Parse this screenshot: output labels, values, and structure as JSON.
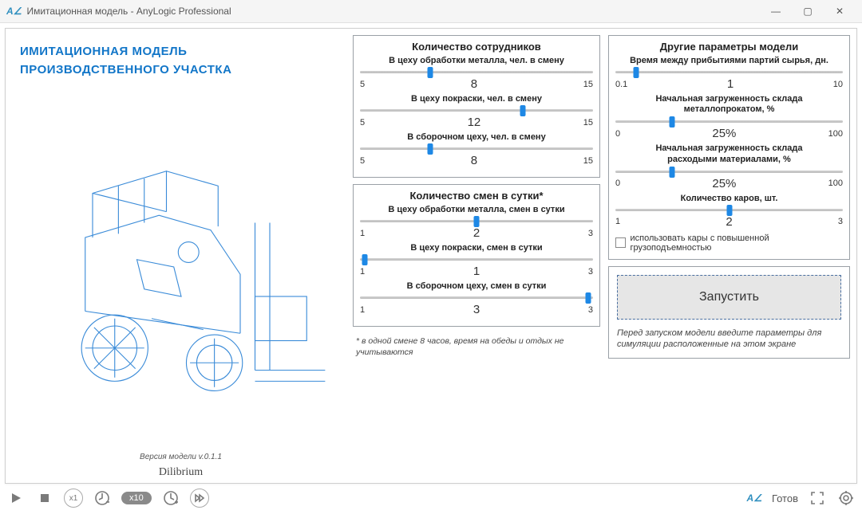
{
  "window": {
    "title": "Имитационная модель - AnyLogic Professional"
  },
  "model": {
    "heading_line1": "ИМИТАЦИОННАЯ МОДЕЛЬ",
    "heading_line2": "ПРОИЗВОДСТВЕННОГО УЧАСТКА",
    "version": "Версия модели v.0.1.1",
    "brand": "Dilibrium"
  },
  "panels": {
    "employees": {
      "title": "Количество сотрудников",
      "sliders": [
        {
          "label": "В цеху обработки металла, чел. в смену",
          "min": "5",
          "max": "15",
          "value": "8",
          "pos": 30
        },
        {
          "label": "В цеху покраски, чел. в смену",
          "min": "5",
          "max": "15",
          "value": "12",
          "pos": 70
        },
        {
          "label": "В сборочном цеху, чел. в смену",
          "min": "5",
          "max": "15",
          "value": "8",
          "pos": 30
        }
      ]
    },
    "shifts": {
      "title": "Количество смен в сутки*",
      "sliders": [
        {
          "label": "В цеху обработки металла, смен в сутки",
          "min": "1",
          "max": "3",
          "value": "2",
          "pos": 50
        },
        {
          "label": "В цеху покраски, смен в сутки",
          "min": "1",
          "max": "3",
          "value": "1",
          "pos": 2
        },
        {
          "label": "В сборочном цеху, смен в сутки",
          "min": "1",
          "max": "3",
          "value": "3",
          "pos": 98
        }
      ],
      "footnote": "* в одной смене 8 часов, время на обеды и отдых не учитываются"
    },
    "other": {
      "title": "Другие параметры модели",
      "sliders": [
        {
          "label": "Время между прибытиями партий сырья, дн.",
          "label2": "",
          "min": "0.1",
          "max": "10",
          "value": "1",
          "pos": 9
        },
        {
          "label": "Начальная загруженность склада",
          "label2": "металлопрокатом, %",
          "min": "0",
          "max": "100",
          "value": "25%",
          "pos": 25
        },
        {
          "label": "Начальная загруженность склада",
          "label2": "расходыми материалами, %",
          "min": "0",
          "max": "100",
          "value": "25%",
          "pos": 25
        },
        {
          "label": "Количество каров, шт.",
          "label2": "",
          "min": "1",
          "max": "3",
          "value": "2",
          "pos": 50
        }
      ],
      "checkbox_label": "использовать кары с повышенной грузоподъемностью",
      "checkbox_checked": false
    }
  },
  "run": {
    "button": "Запустить",
    "note": "Перед запуском модели введите параметры для симуляции расположенные на этом экране"
  },
  "playbar": {
    "speed_pill": "x10",
    "status": "Готов"
  }
}
